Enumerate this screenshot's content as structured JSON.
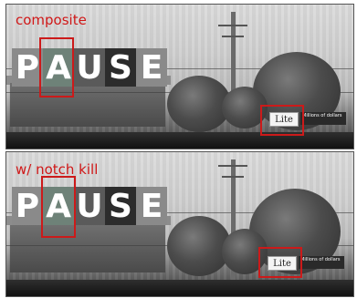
{
  "panels": [
    {
      "caption": "composite",
      "title_letters": [
        "P",
        "A",
        "U",
        "S",
        "E"
      ],
      "sign_label": "Lite",
      "sign_fine_text": "Millions of dollars"
    },
    {
      "caption": "w/ notch kill",
      "title_letters": [
        "P",
        "A",
        "U",
        "S",
        "E"
      ],
      "sign_label": "Lite",
      "sign_fine_text": "Millions of dollars"
    }
  ],
  "colors": {
    "caption": "#d01818",
    "highlight_box": "#cc1a1a",
    "letter": "#ffffff"
  }
}
